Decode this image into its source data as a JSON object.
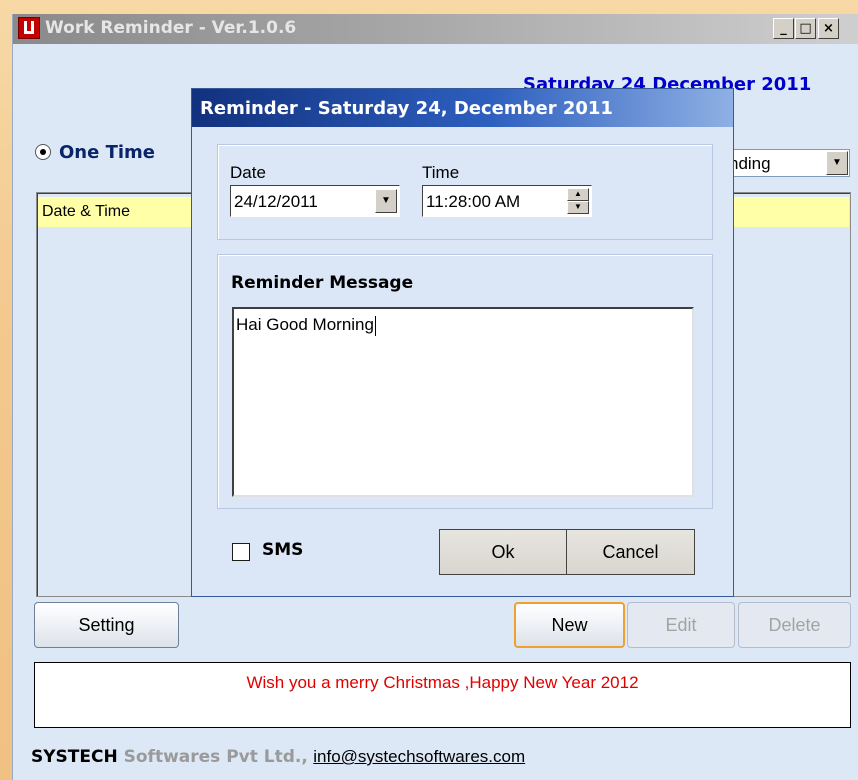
{
  "window": {
    "title": "Work Reminder - Ver.1.0.6",
    "controls": {
      "minimize": "_",
      "maximize": "□",
      "close": "×"
    }
  },
  "header": {
    "date_display": "Saturday 24 December 2011"
  },
  "mode": {
    "radio_label": "One Time",
    "selected": true
  },
  "filter_combo": {
    "value": "nding"
  },
  "list": {
    "columns": [
      "Date & Time"
    ]
  },
  "buttons": {
    "setting": "Setting",
    "new": "New",
    "edit": "Edit",
    "delete": "Delete"
  },
  "marquee_message": "Wish you a merry Christmas ,Happy New Year 2012",
  "footer": {
    "company": "SYSTECH",
    "company_suffix": " Softwares Pvt Ltd.,",
    "email": "info@systechsoftwares.com"
  },
  "dialog": {
    "title": "Reminder - Saturday 24, December 2011",
    "date_label": "Date",
    "date_value": "24/12/2011",
    "time_label": "Time",
    "time_value": "11:28:00 AM",
    "message_label": "Reminder Message",
    "message_text": "Hai Good Morning",
    "sms_label": "SMS",
    "sms_checked": false,
    "ok_label": "Ok",
    "cancel_label": "Cancel"
  },
  "colors": {
    "window_bg": "#dde8f7",
    "dialog_title": "#12317e",
    "date_blue": "#0000cc",
    "marquee_red": "#e00000",
    "list_header": "#ffffa8",
    "focus_border": "#f0a030"
  }
}
